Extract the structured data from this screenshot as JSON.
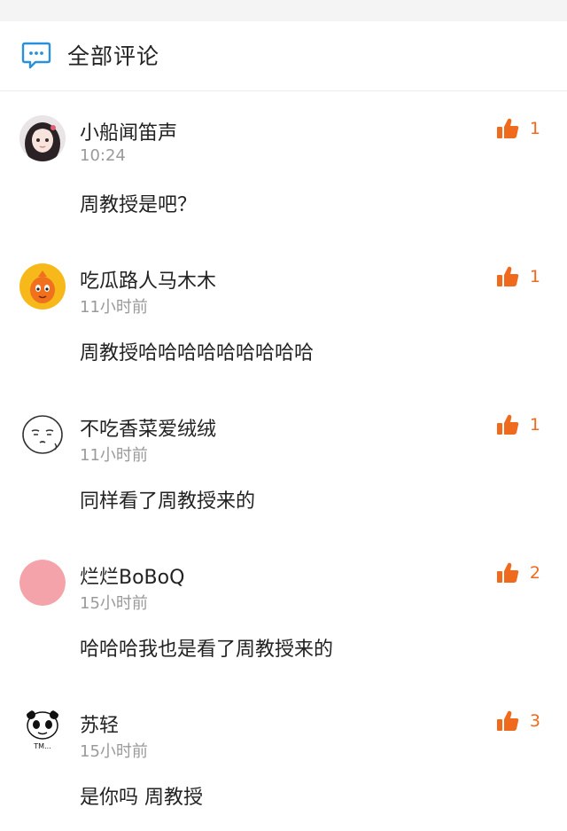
{
  "header": {
    "title": "全部评论",
    "icon": "comment-bubble-icon"
  },
  "colors": {
    "accent": "#f06a1d",
    "icon_blue": "#2b90d9",
    "timestamp": "#9a9a9a"
  },
  "comments": [
    {
      "username": "小船闻笛声",
      "time": "10:24",
      "text": "周教授是吧？",
      "likes": "1",
      "avatar": "girl-portrait-avatar"
    },
    {
      "username": "吃瓜路人马木木",
      "time": "11小时前",
      "text": "周教授哈哈哈哈哈哈哈哈哈",
      "likes": "1",
      "avatar": "orange-mascot-avatar"
    },
    {
      "username": "不吃香菜爱绒绒",
      "time": "11小时前",
      "text": "同样看了周教授来的",
      "likes": "1",
      "avatar": "sketch-face-avatar"
    },
    {
      "username": "烂烂BoBoQ",
      "time": "15小时前",
      "text": "哈哈哈我也是看了周教授来的",
      "likes": "2",
      "avatar": "pink-circle-avatar"
    },
    {
      "username": "苏轻",
      "time": "15小时前",
      "text": "是你吗 周教授",
      "likes": "3",
      "avatar": "meme-panda-avatar",
      "avatar_caption": "TM..."
    }
  ]
}
